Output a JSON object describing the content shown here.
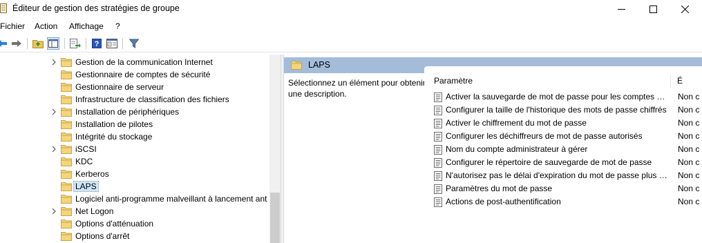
{
  "window": {
    "title": "Éditeur de gestion des stratégies de groupe",
    "icon": "gpo-editor-icon"
  },
  "menu": [
    {
      "label": "Fichier"
    },
    {
      "label": "Action"
    },
    {
      "label": "Affichage"
    },
    {
      "label": "?"
    }
  ],
  "toolbar": {
    "buttons": [
      "back-arrow-icon",
      "forward-arrow-icon",
      "up-folder-icon",
      "show-hide-tree-icon",
      "export-list-icon",
      "help-icon",
      "properties-icon",
      "filter-icon"
    ]
  },
  "tree": {
    "items": [
      {
        "label": "Gestion de la communication Internet",
        "expandable": true
      },
      {
        "label": "Gestionnaire de comptes de sécurité",
        "expandable": false
      },
      {
        "label": "Gestionnaire de serveur",
        "expandable": false
      },
      {
        "label": "Infrastructure de classification des fichiers",
        "expandable": false
      },
      {
        "label": "Installation de périphériques",
        "expandable": true
      },
      {
        "label": "Installation de pilotes",
        "expandable": false
      },
      {
        "label": "Intégrité du stockage",
        "expandable": false
      },
      {
        "label": "iSCSI",
        "expandable": true
      },
      {
        "label": "KDC",
        "expandable": false
      },
      {
        "label": "Kerberos",
        "expandable": false
      },
      {
        "label": "LAPS",
        "expandable": false,
        "selected": true
      },
      {
        "label": "Logiciel anti-programme malveillant à lancement ant",
        "expandable": false
      },
      {
        "label": "Net Logon",
        "expandable": true
      },
      {
        "label": "Options d'atténuation",
        "expandable": false
      },
      {
        "label": "Options d'arrêt",
        "expandable": false
      }
    ]
  },
  "details": {
    "title": "LAPS",
    "description": "Sélectionnez un élément pour obtenir une description.",
    "columns": {
      "name": "Paramètre",
      "state": "É"
    },
    "rows": [
      {
        "name": "Activer la sauvegarde de mot de passe pour les comptes DS...",
        "state": "Non c"
      },
      {
        "name": "Configurer la taille de l'historique des mots de passe chiffrés",
        "state": "Non c"
      },
      {
        "name": "Activer le chiffrement du mot de passe",
        "state": "Non c"
      },
      {
        "name": "Configurer les déchiffreurs de mot de passe autorisés",
        "state": "Non c"
      },
      {
        "name": "Nom du compte administrateur à gérer",
        "state": "Non c"
      },
      {
        "name": "Configurer le répertoire de sauvegarde de mot de passe",
        "state": "Non c"
      },
      {
        "name": "N'autorisez pas le délai d'expiration du mot de passe plus lo...",
        "state": "Non c"
      },
      {
        "name": "Paramètres du mot de passe",
        "state": "Non c"
      },
      {
        "name": "Actions de post-authentification",
        "state": "Non c"
      }
    ]
  }
}
